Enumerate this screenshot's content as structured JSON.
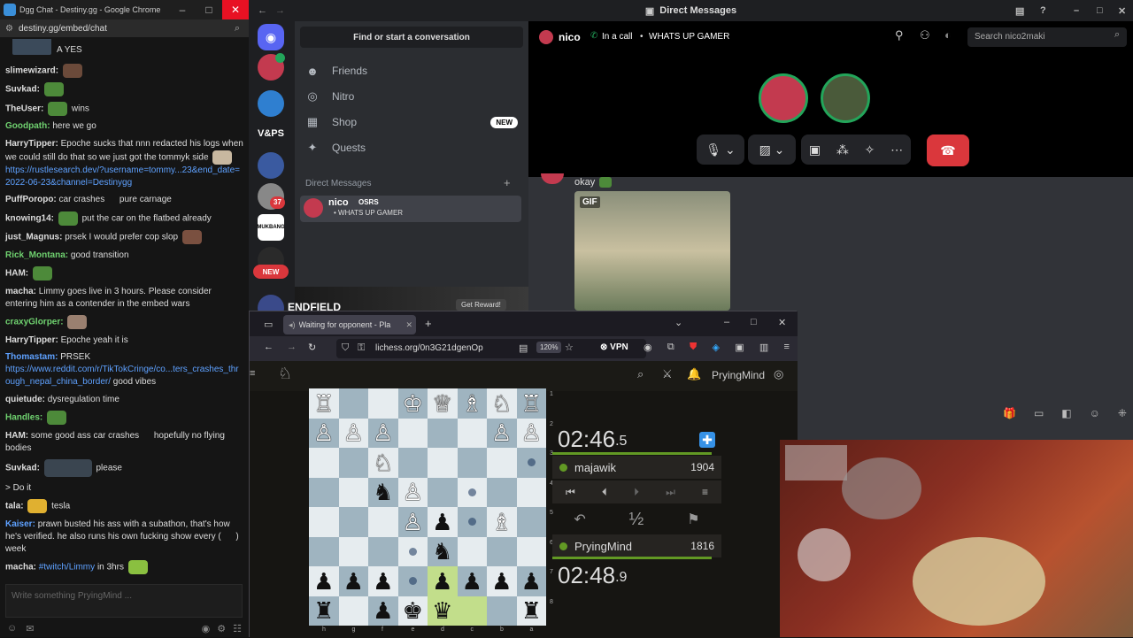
{
  "chat_window": {
    "title": "Dgg Chat - Destiny.gg - Google Chrome",
    "url": "destiny.gg/embed/chat",
    "controls": {
      "minimize": "–",
      "maximize": "□",
      "close": "✕"
    },
    "messages": [
      {
        "nick": "",
        "text": "A YES",
        "nick_color": "#ddd"
      },
      {
        "nick": "slimewizard:",
        "text": "",
        "nick_color": "#ddd"
      },
      {
        "nick": "Suvkad:",
        "text": "",
        "nick_color": "#ddd"
      },
      {
        "nick": "TheUser:",
        "text": "wins",
        "nick_color": "#ddd"
      },
      {
        "nick": "Goodpath:",
        "text": "here we go",
        "nick_color": "#6fd16f"
      },
      {
        "nick": "HarryTipper:",
        "text": "Epoche sucks that nnn redacted his logs when we could still do that so we just got the tommyk side",
        "nick_color": "#ddd"
      },
      {
        "nick": "",
        "text": "",
        "link": "https://rustlesearch.dev/?username=tommy...23&end_date=2022-06-23&channel=Destinygg",
        "nick_color": "#ddd"
      },
      {
        "nick": "PuffPoropo:",
        "text": "car crashes      pure carnage",
        "nick_color": "#ddd"
      },
      {
        "nick": "knowing14:",
        "text": "put the car on the flatbed already",
        "nick_color": "#ddd"
      },
      {
        "nick": "just_Magnus:",
        "text": "prsek I would prefer cop slop",
        "nick_color": "#ddd"
      },
      {
        "nick": "Rick_Montana:",
        "text": "good transition",
        "nick_color": "#6fd16f"
      },
      {
        "nick": "HAM:",
        "text": "",
        "nick_color": "#ddd"
      },
      {
        "nick": "macha:",
        "text": "Limmy goes live in 3 hours. Please consider entering him as a contender in the embed wars",
        "nick_color": "#ddd"
      },
      {
        "nick": "craxyGlorper:",
        "text": "",
        "nick_color": "#6fd16f"
      },
      {
        "nick": "HarryTipper:",
        "text": "Epoche yeah it is",
        "nick_color": "#ddd"
      },
      {
        "nick": "Thomastam:",
        "text": "PRSEK",
        "nick_color": "#5ea1ff"
      },
      {
        "nick": "",
        "text": "good vibes",
        "link": "https://www.reddit.com/r/TikTokCringe/co...ters_crashes_through_nepal_china_border/",
        "nick_color": "#ddd"
      },
      {
        "nick": "quietude:",
        "text": "dysregulation time",
        "nick_color": "#ddd"
      },
      {
        "nick": "Handles:",
        "text": "",
        "nick_color": "#6fd16f"
      },
      {
        "nick": "HAM:",
        "text": "some good ass car crashes      hopefully no flying bodies",
        "nick_color": "#ddd"
      },
      {
        "nick": "Suvkad:",
        "text": "please",
        "nick_color": "#ddd"
      },
      {
        "nick": "",
        "text": "> Do it",
        "nick_color": "#ddd"
      },
      {
        "nick": "tala:",
        "text": "tesla",
        "nick_color": "#ddd"
      },
      {
        "nick": "Kaiser:",
        "text": "prawn busted his ass with a subathon, that's how he's verified. he also runs his own fucking show every (      ) week",
        "nick_color": "#5ea1ff"
      },
      {
        "nick": "macha:",
        "text": "in 3hrs",
        "link": "#twitch/Limmy",
        "nick_color": "#ddd"
      }
    ],
    "input_placeholder": "Write something PryingMind ..."
  },
  "discord": {
    "title": "Direct Messages",
    "search_placeholder": "Find or start a conversation",
    "nav": [
      {
        "label": "Friends",
        "icon": "friends-icon"
      },
      {
        "label": "Nitro",
        "icon": "nitro-icon"
      },
      {
        "label": "Shop",
        "icon": "shop-icon",
        "badge": "NEW"
      },
      {
        "label": "Quests",
        "icon": "quests-icon"
      }
    ],
    "dm_label": "Direct Messages",
    "dm_add": "+",
    "dm_item": {
      "name": "nico",
      "tag": "OSRS",
      "status": "• WHATS UP GAMER"
    },
    "server_labels": {
      "vnps": "V&PS",
      "badge_count": "37",
      "new_badge": "NEW",
      "mukbang": "MUKBANG"
    },
    "banner_title": "ENDFIELD",
    "banner_button": "Get Reward!",
    "header": {
      "name": "nico",
      "call": "In a call",
      "status": "WHATS UP GAMER",
      "search": "Search nico2maki"
    },
    "chat": {
      "text": "okay",
      "gif_label": "GIF"
    },
    "accent": "#5865f2",
    "hangup_color": "#da373c"
  },
  "browser": {
    "tab_title": "Waiting for opponent - Pla",
    "url": "lichess.org/0n3G21dgenOp",
    "zoom": "120%",
    "vpn": "VPN",
    "user": "PryingMind",
    "top_clock": {
      "big": "02:46",
      "small": ".5"
    },
    "bottom_clock": {
      "big": "02:48",
      "small": ".9"
    },
    "opponent": {
      "name": "majawik",
      "rating": "1904"
    },
    "me": {
      "name": "PryingMind",
      "rating": "1816"
    },
    "half": "½",
    "rank_labels": [
      "1",
      "2",
      "3",
      "4",
      "5",
      "6",
      "7",
      "8"
    ],
    "file_labels": [
      "h",
      "g",
      "f",
      "e",
      "d",
      "c",
      "b",
      "a"
    ]
  }
}
